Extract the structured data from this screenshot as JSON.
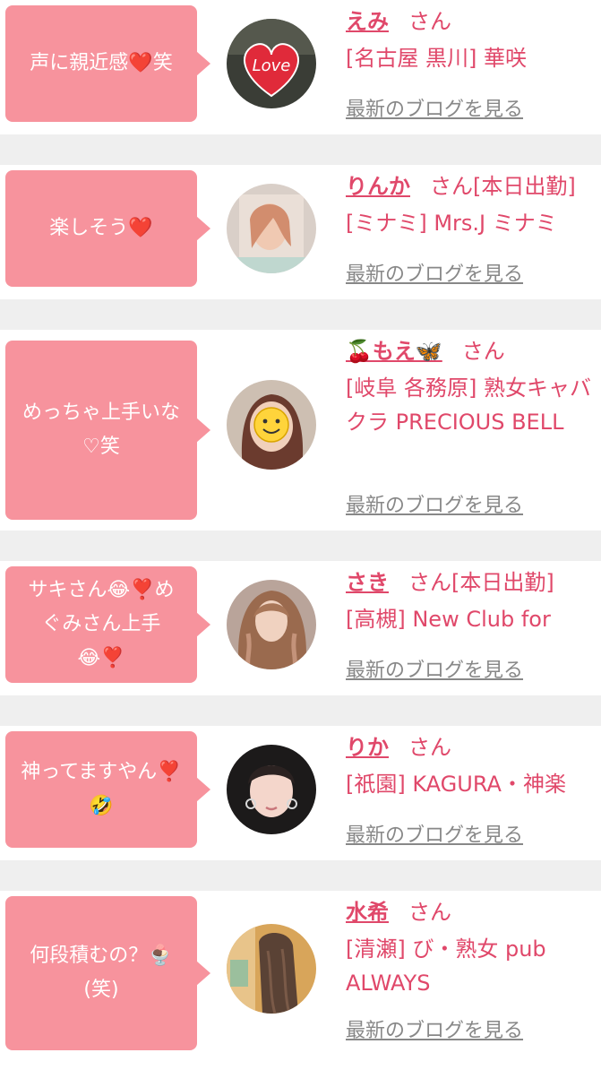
{
  "items": [
    {
      "comment": "声に親近感❤️笑",
      "name": "えみ",
      "san": "さん",
      "shop": "[名古屋 黒川] 華咲",
      "blog": "最新のブログを見る"
    },
    {
      "comment": "楽しそう❤️",
      "name": "りんか",
      "san": "さん[本日出勤]",
      "shop": "[ミナミ] Mrs.J ミナミ",
      "blog": "最新のブログを見る"
    },
    {
      "comment": "めっちゃ上手いな\n♡笑",
      "name": "🍒もえ🦋",
      "san": "さん",
      "shop": "[岐阜 各務原] 熟女キャバクラ PRECIOUS BELL",
      "blog": "最新のブログを見る"
    },
    {
      "comment": "サキさん😂❣️め\nぐみさん上手\n😂❣️",
      "name": "さき",
      "san": "さん[本日出勤]",
      "shop": "[高槻] New Club for",
      "blog": "最新のブログを見る"
    },
    {
      "comment": "神ってますやん❣️\n🤣",
      "name": "りか",
      "san": "さん",
      "shop": "[祇園] KAGURA・神楽",
      "blog": "最新のブログを見る"
    },
    {
      "comment": "何段積むの？🍨\n(笑)",
      "name": "水希",
      "san": "さん",
      "shop": "[清瀬] び・熟女 pub ALWAYS",
      "blog": "最新のブログを見る"
    }
  ],
  "avatars": [
    "love-heart-photo",
    "woman-photo-blurred",
    "smiley-face-photo",
    "woman-photo-wavy-hair",
    "woman-photo-earrings",
    "woman-photo-back"
  ],
  "colors": {
    "bubble": "#f7939d",
    "accent": "#e0486a",
    "separator": "#efefef",
    "link_gray": "#888888"
  }
}
